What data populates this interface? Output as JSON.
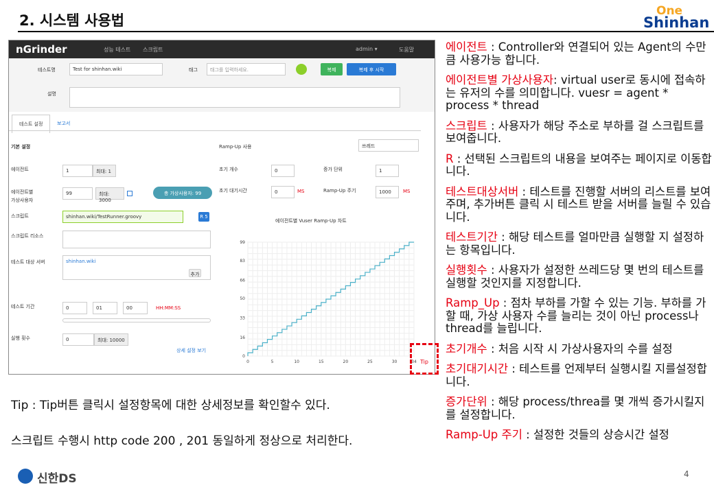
{
  "slide": {
    "title": "2. 시스템 사용법",
    "logo_top": "One",
    "logo_bottom": "Shinhan",
    "tip_line1": "Tip : Tip버튼 클릭시 설정항목에 대한 상세정보를 확인할수 있다.",
    "tip_line2": "스크립트 수행시 http code 200 , 201 동일하게 정상으로 처리한다.",
    "footer_logo": "신한DS",
    "page_number": "4"
  },
  "app": {
    "brand": "nGrinder",
    "nav": [
      "성능 테스트",
      "스크립트"
    ],
    "user": "admin ▾",
    "help": "도움말",
    "test_name_label": "테스트명",
    "test_name_value": "Test for shinhan.wiki",
    "tag_label": "태그",
    "tag_placeholder": "태그를 입력하세요.",
    "clone_btn": "복제",
    "clone_run_btn": "복제 후 시작",
    "desc_label": "설명",
    "tabs": [
      "테스트 설정",
      "보고서"
    ],
    "basic_settings": "기본 설정",
    "agent_label": "에이전트",
    "agent_value": "1",
    "agent_max": "최대: 1",
    "vuser_label1": "에이전트별",
    "vuser_label2": "가상사용자",
    "vuser_value": "99",
    "vuser_max": "최대: 3000",
    "total_vuser": "총 가상사용자: 99",
    "script_label": "스크립트",
    "script_value": "shinhan.wiki/TestRunner.groovy",
    "r_btn": "R 5",
    "script_res_label": "스크립트 리소스",
    "target_label": "테스트 대상 서버",
    "target_value": "shinhan.wiki",
    "add_btn": "추가",
    "duration_label": "테스트 기간",
    "dur_h": "0",
    "dur_m": "01",
    "dur_s": "00",
    "dur_fmt": "HH:MM:SS",
    "runcount_label": "실행 횟수",
    "run_value": "0",
    "run_max": "최대: 10000",
    "detail_link": "상세 설정 보기",
    "rampup_check": "Ramp-Up 사용",
    "rampup_type": "쓰레드",
    "init_count_label": "초기 개수",
    "init_count": "0",
    "incr_label": "증가 단위",
    "incr": "1",
    "init_wait_label": "초기 대기시간",
    "init_wait": "0",
    "ms1": "MS",
    "period_label": "Ramp-Up 주기",
    "period": "1000",
    "ms2": "MS",
    "chart_title": "에이전트별 Vuser Ramp-Up 차트",
    "tip_btn": "Tip"
  },
  "chart_data": {
    "type": "line",
    "title": "에이전트별 Vuser Ramp-Up 차트",
    "x": [
      0,
      5,
      10,
      15,
      20,
      25,
      30,
      34
    ],
    "y_ticks": [
      0,
      16,
      33,
      50,
      66,
      83,
      99
    ],
    "x_ticks": [
      0,
      5,
      10,
      15,
      20,
      25,
      30,
      34
    ],
    "series": [
      {
        "values_start": 0,
        "values_end": 99,
        "steps": 34
      }
    ],
    "ylim": [
      0,
      99
    ],
    "xlim": [
      0,
      34
    ]
  },
  "notes": [
    {
      "key": "에이전트",
      "text": " : Controller와 연결되어 있는 Agent의 수만큼 사용가능 합니다."
    },
    {
      "key": "에이전트별 가상사용자",
      "text": ": virtual user로 동시에 접속하는 유저의 수를 의미합니다. vuesr = agent * process * thread"
    },
    {
      "key": "스크립트",
      "text": " : 사용자가 해당 주소로 부하를 걸 스크립트를 보여줍니다."
    },
    {
      "key": "R",
      "text": " : 선택된 스크립트의 내용을 보여주는 페이지로 이동합니다."
    },
    {
      "key": "테스트대상서버",
      "text": " : 테스트를 진행할 서버의 리스트를 보여주며, 추가버튼 클릭 시 테스트 받을 서버를 늘릴 수 있습니다."
    },
    {
      "key": "테스트기간",
      "text": " : 해당 테스트를 얼마만큼 실행할 지 설정하는 항목입니다."
    },
    {
      "key": "실행횟수",
      "text": " : 사용자가 설정한 쓰레드당 몇 번의 테스트를 실행할 것인지를 지정합니다."
    },
    {
      "key": "Ramp_Up",
      "text": " : 점차 부하를 가할 수 있는 기능. 부하를 가할 때, 가상 사용자 수를 늘리는 것이 아닌 process나 thread를 늘립니다."
    },
    {
      "key": "초기개수",
      "text": " : 처음 시작 시 가상사용자의 수를 설정"
    },
    {
      "key": "초기대기시간",
      "text": " : 테스트를 언제부터 실행시킬 지를설정합니다."
    },
    {
      "key": "증가단위",
      "text": " : 해당 process/threa를 몇 개씩 증가시킬지를 설정합니다."
    },
    {
      "key": "Ramp-Up 주기",
      "text": " : 설정한 것들의 상승시간 설정"
    }
  ]
}
